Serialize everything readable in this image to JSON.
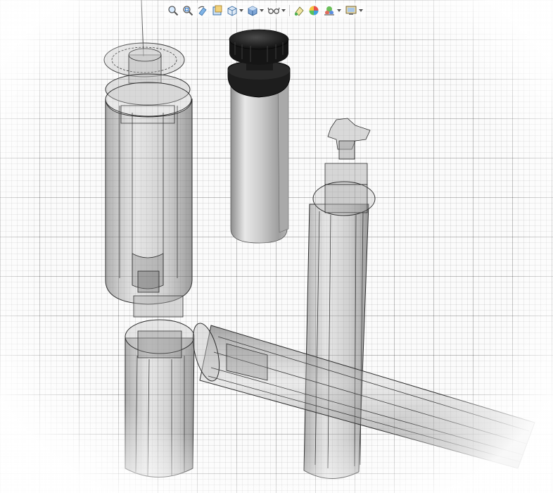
{
  "app": {
    "view": "3d-viewport"
  },
  "colors": {
    "background": "#ffffff",
    "grid_major": "#cfcfcf",
    "grid_minor": "#ececec",
    "translucent_body": "#a9a9a9",
    "edge": "#2a2a2a",
    "knob": "#1c1c1c",
    "shaded_body": "#c8c8c8"
  },
  "toolbar": {
    "tools": [
      {
        "name": "zoom-to-fit",
        "icon": "magnifier-plus-icon",
        "has_menu": false
      },
      {
        "name": "zoom-to-area",
        "icon": "magnifier-area-icon",
        "has_menu": false
      },
      {
        "name": "previous-view",
        "icon": "previous-view-icon",
        "has_menu": false
      },
      {
        "name": "section-view",
        "icon": "section-view-icon",
        "has_menu": false
      },
      {
        "name": "view-orientation",
        "icon": "view-orientation-icon",
        "has_menu": true
      },
      {
        "name": "display-style",
        "icon": "display-style-cube-icon",
        "has_menu": true
      },
      {
        "name": "hide-show-items",
        "icon": "glasses-icon",
        "has_menu": true
      },
      {
        "name": "edit-appearance",
        "icon": "appearance-icon",
        "has_menu": false
      },
      {
        "name": "apply-scene",
        "icon": "scene-sphere-icon",
        "has_menu": false
      },
      {
        "name": "view-settings",
        "icon": "view-settings-icon",
        "has_menu": true
      },
      {
        "name": "display-manager",
        "icon": "monitor-icon",
        "has_menu": true
      }
    ]
  },
  "model": {
    "parts": [
      {
        "name": "upper-tube-transparent",
        "display": "transparent"
      },
      {
        "name": "clamp-knob-sleeve",
        "display": "shaded"
      },
      {
        "name": "right-upright-tube",
        "display": "transparent"
      },
      {
        "name": "lower-left-tube",
        "display": "transparent"
      },
      {
        "name": "horizontal-crossbar",
        "display": "transparent"
      }
    ]
  }
}
